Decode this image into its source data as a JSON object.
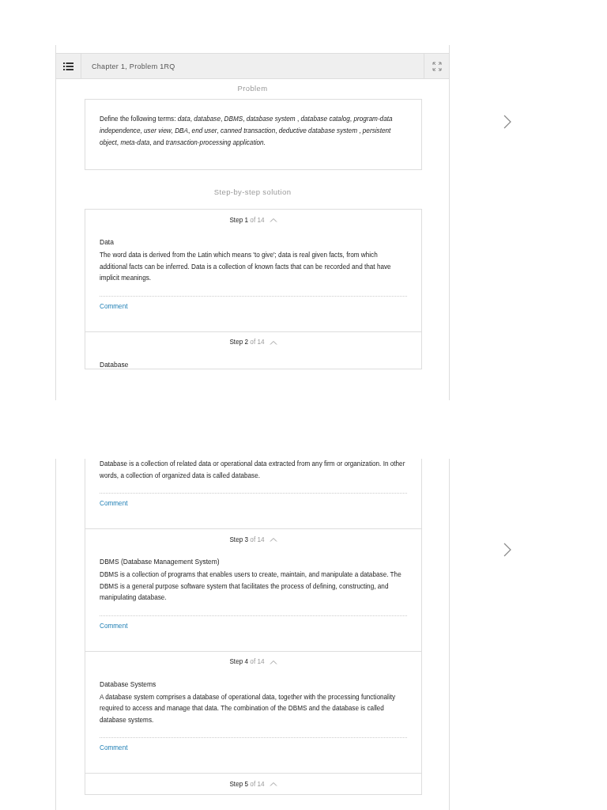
{
  "pages": [
    {
      "header": {
        "title": "Chapter 1, Problem 1RQ"
      },
      "problem_label": "Problem",
      "problem_text": "Define the following terms: *data*, *database*, *DBMS*, *database system* , *database catalog*, *program-data independence*, *user view*, *DBA*, *end user*, *canned transaction*, *deductive database system* , *persistent object*, *meta-data*, and *transaction-processing application*.",
      "solution_label": "Step-by-step solution",
      "steps": [
        {
          "step": "Step 1",
          "of": "of 14",
          "expanded": true,
          "heading": "Data",
          "body": "The word data is derived from the Latin which means 'to give'; data is real given facts, from which additional facts can be inferred. Data is a collection of known facts that can be recorded and that have implicit meanings.",
          "comment": "Comment"
        },
        {
          "step": "Step 2",
          "of": "of 14",
          "expanded": true,
          "heading": "Database"
        }
      ]
    },
    {
      "steps": [
        {
          "body": "Database is a collection of related data or operational data extracted from any firm or organization. In other words, a collection of organized data is called database.",
          "comment": "Comment"
        },
        {
          "step": "Step 3",
          "of": "of 14",
          "expanded": true,
          "heading": "DBMS (Database Management System)",
          "body": "DBMS is a collection of programs that enables users to create, maintain, and manipulate a database. The DBMS is a general purpose software system that facilitates the process of defining, constructing, and manipulating database.",
          "comment": "Comment"
        },
        {
          "step": "Step 4",
          "of": "of 14",
          "expanded": true,
          "heading": "Database Systems",
          "body": "A database system comprises a database of operational data, together with the processing functionality required to access and manage that data. The combination of the DBMS and the database is called database systems.",
          "comment": "Comment"
        },
        {
          "step": "Step 5",
          "of": "of 14",
          "expanded": true
        }
      ]
    }
  ]
}
